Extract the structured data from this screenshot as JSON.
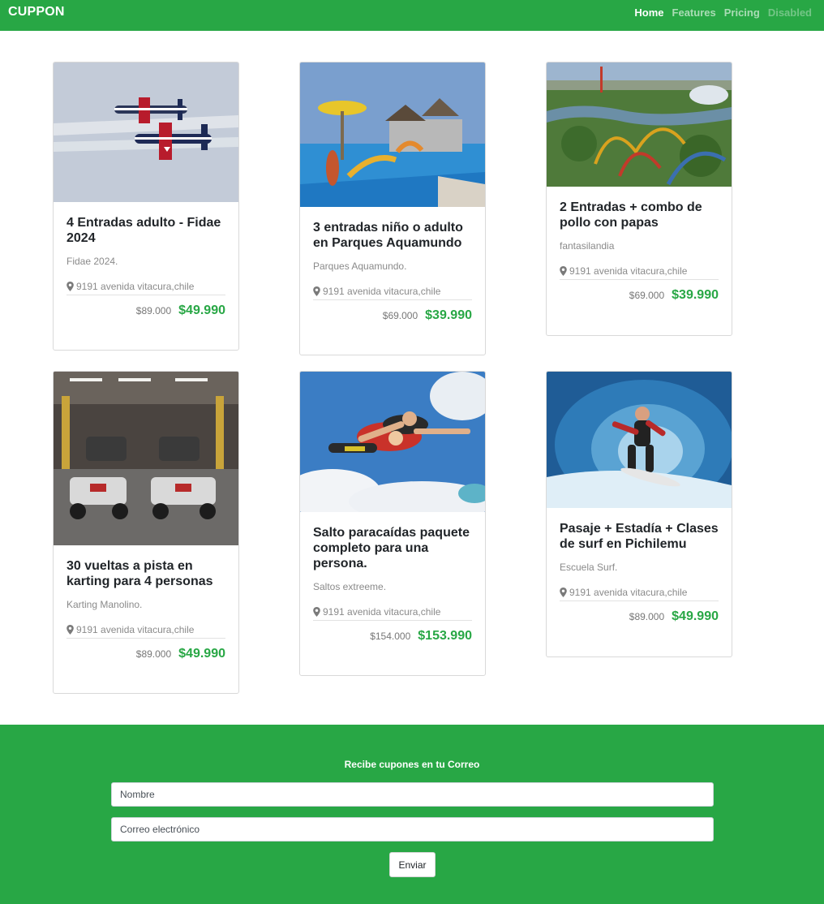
{
  "navbar": {
    "brand": "CUPPON",
    "links": [
      {
        "label": "Home"
      },
      {
        "label": "Features"
      },
      {
        "label": "Pricing"
      },
      {
        "label": "Disabled"
      }
    ]
  },
  "cards": [
    {
      "title": "4 Entradas adulto - Fidae 2024",
      "description": "Fidae 2024.",
      "location": "9191 avenida vitacura,chile",
      "old_price": "$89.000",
      "price": "$49.990",
      "image": "airshow-planes"
    },
    {
      "title": "3 entradas niño o adulto en Parques Aquamundo",
      "description": "Parques Aquamundo.",
      "location": "9191 avenida vitacura,chile",
      "old_price": "$69.000",
      "price": "$39.990",
      "image": "water-park"
    },
    {
      "title": "2 Entradas + combo de pollo con papas",
      "description": "fantasilandia",
      "location": "9191 avenida vitacura,chile",
      "old_price": "$69.000",
      "price": "$39.990",
      "image": "amusement-park"
    },
    {
      "title": "30 vueltas a pista en karting para 4 personas",
      "description": "Karting Manolino.",
      "location": "9191 avenida vitacura,chile",
      "old_price": "$89.000",
      "price": "$49.990",
      "image": "karting-track"
    },
    {
      "title": "Salto paracaídas paquete completo para una persona.",
      "description": "Saltos extreeme.",
      "location": "9191 avenida vitacura,chile",
      "old_price": "$154.000",
      "price": "$153.990",
      "image": "skydivers"
    },
    {
      "title": "Pasaje + Estadía + Clases de surf en Pichilemu",
      "description": "Escuela Surf.",
      "location": "9191 avenida vitacura,chile",
      "old_price": "$89.000",
      "price": "$49.990",
      "image": "surfer-wave"
    }
  ],
  "footer": {
    "title": "Recibe cupones en tu Correo",
    "name_placeholder": "Nombre",
    "email_placeholder": "Correo electrónico",
    "submit_label": "Enviar"
  },
  "colors": {
    "brand_green": "#28a745",
    "price_green": "#28a745"
  }
}
